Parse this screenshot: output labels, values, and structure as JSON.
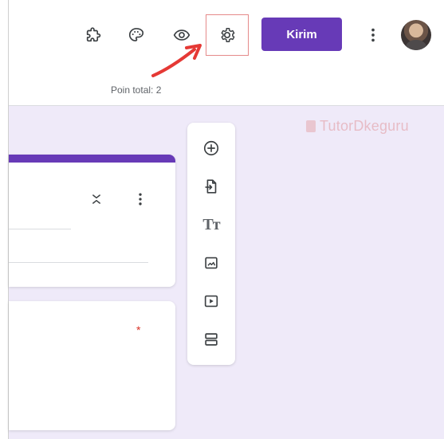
{
  "toolbar": {
    "send_label": "Kirim",
    "total_points": "Poin total: 2",
    "icons": {
      "addons": "puzzle-icon",
      "theme": "palette-icon",
      "preview": "eye-icon",
      "settings": "gear-icon",
      "more": "more-vertical-icon"
    }
  },
  "watermark": {
    "text": "TutorDkeguru"
  },
  "colors": {
    "accent": "#673ab7",
    "canvas": "#efeaf9",
    "arrow": "#e53935",
    "highlight": "#e58a8a"
  },
  "question_card": {
    "required_marker": "*"
  }
}
